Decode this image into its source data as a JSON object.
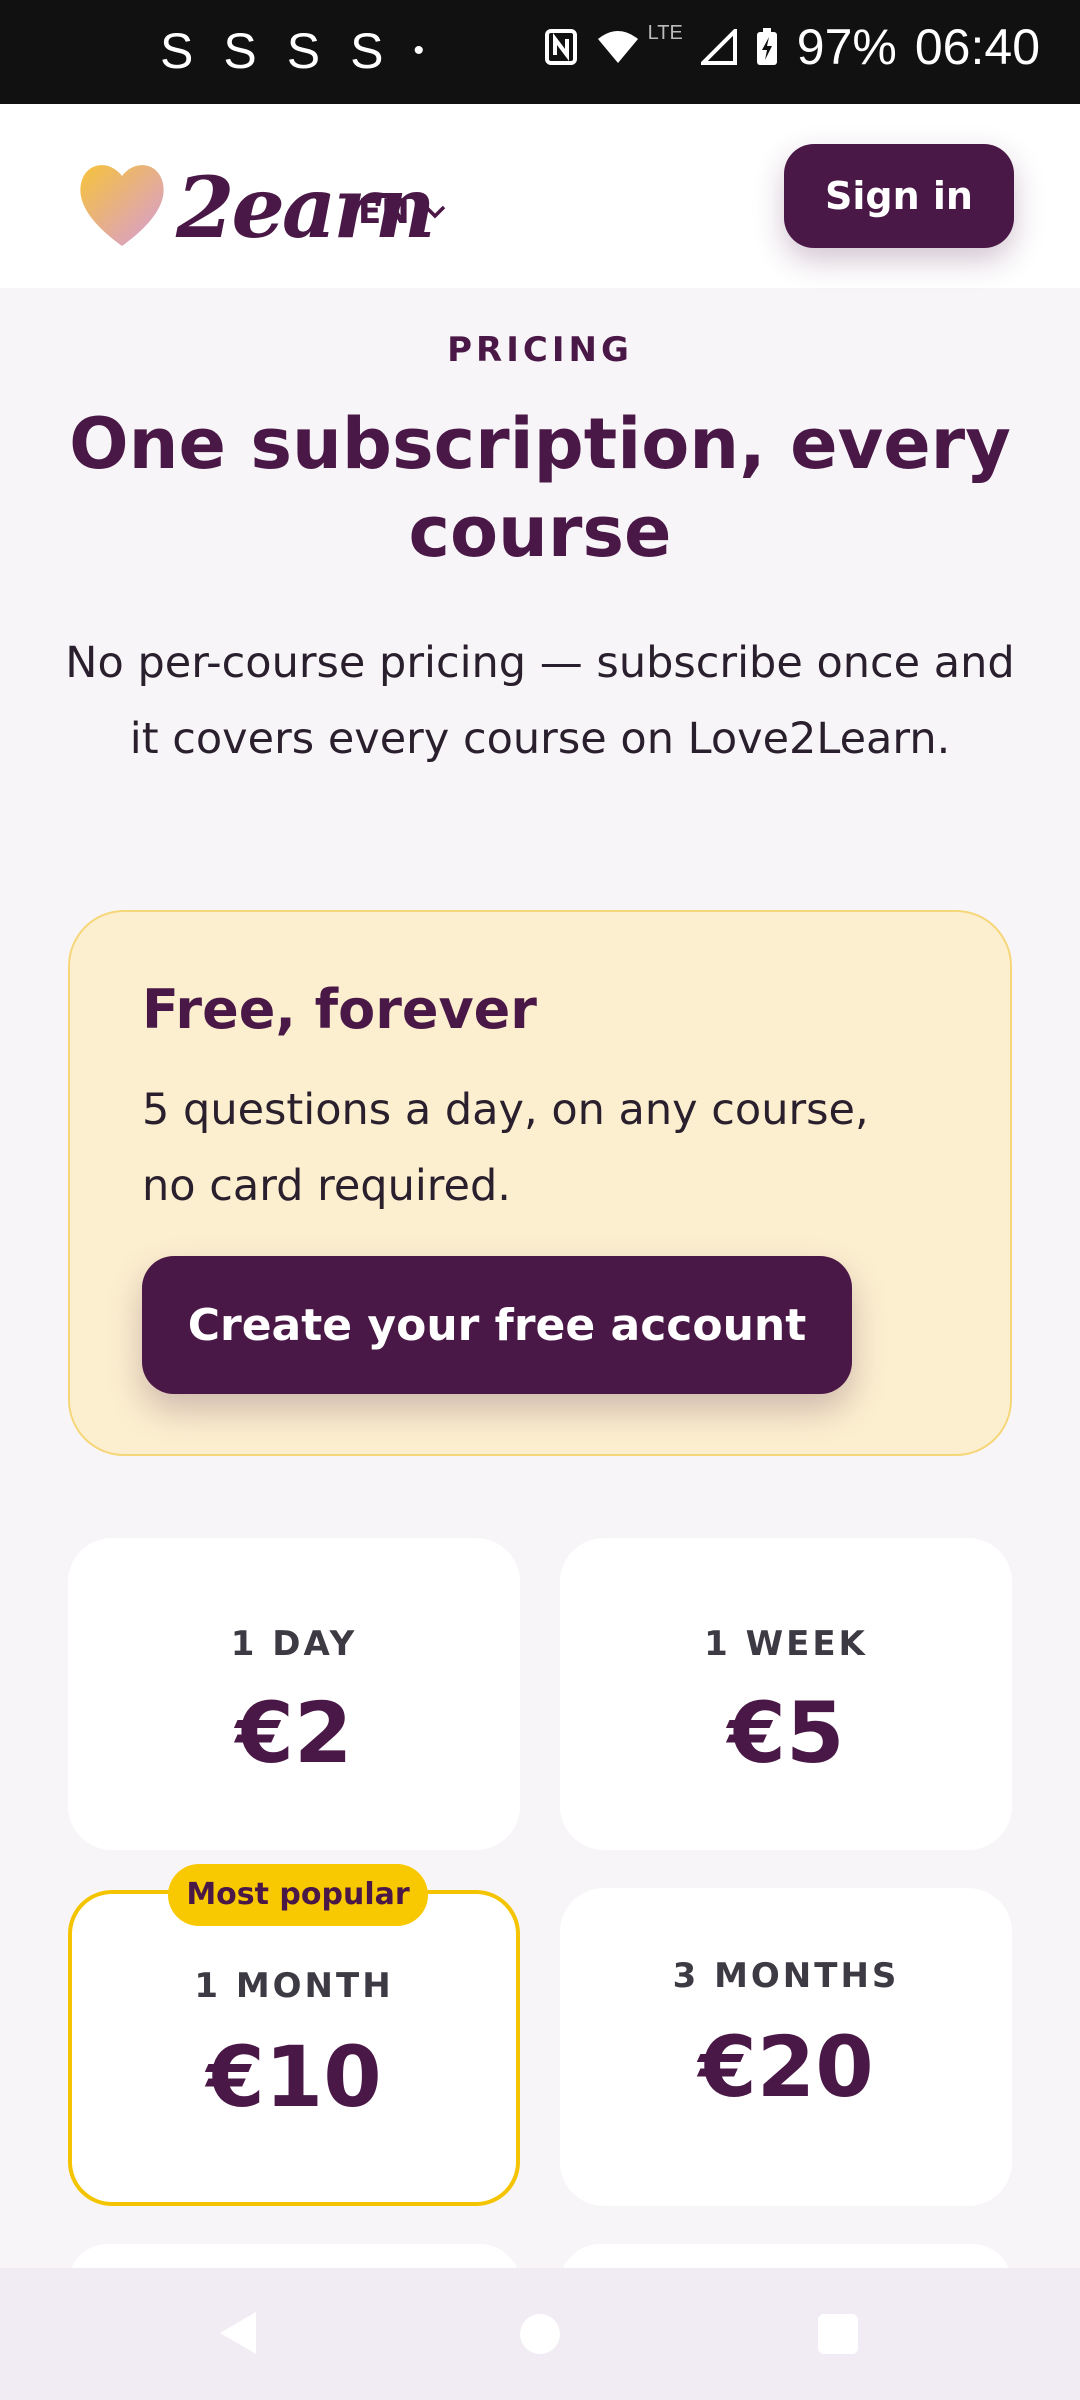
{
  "status_bar": {
    "left_icons": [
      "S",
      "S",
      "S",
      "S",
      "•"
    ],
    "battery": "97%",
    "time": "06:40",
    "network_label": "LTE"
  },
  "header": {
    "logo_text": "2earn",
    "language": "EN",
    "sign_in_label": "Sign in"
  },
  "hero": {
    "eyebrow": "PRICING",
    "title": "One subscription, every course",
    "subtitle": "No per-course pricing — subscribe once and it covers every course on Love2Learn."
  },
  "free_plan": {
    "title": "Free, forever",
    "description": "5 questions a day, on any course, no card required.",
    "cta_label": "Create your free account"
  },
  "plans": [
    {
      "period": "1 DAY",
      "price": "€2"
    },
    {
      "period": "1 WEEK",
      "price": "€5"
    },
    {
      "period": "1 MONTH",
      "price": "€10",
      "badge": "Most popular"
    },
    {
      "period": "3 MONTHS",
      "price": "€20"
    }
  ],
  "colors": {
    "brand_purple": "#4a1846",
    "accent_yellow": "#f8c800",
    "free_card_bg": "#fcefcf"
  }
}
